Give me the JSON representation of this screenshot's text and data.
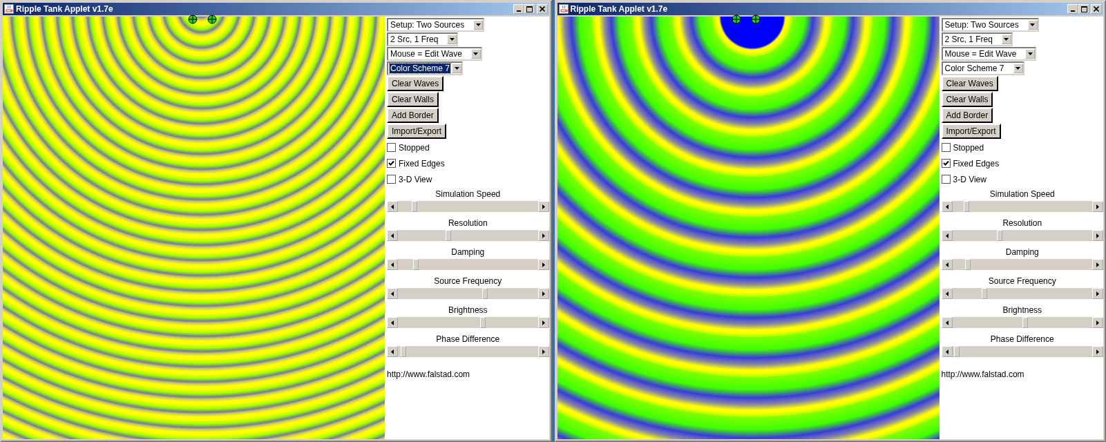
{
  "windows": [
    {
      "title": "Ripple Tank Applet v1.7e",
      "dropdowns": [
        {
          "value": "Setup: Two Sources",
          "focused": false
        },
        {
          "value": "2 Src, 1 Freq",
          "focused": false
        },
        {
          "value": "Mouse = Edit Wave",
          "focused": false
        },
        {
          "value": "Color Scheme 7",
          "focused": true
        }
      ],
      "buttons": [
        "Clear Waves",
        "Clear Walls",
        "Add Border",
        "Import/Export"
      ],
      "checkboxes": [
        {
          "label": "Stopped",
          "checked": false
        },
        {
          "label": "Fixed Edges",
          "checked": true
        },
        {
          "label": "3-D View",
          "checked": false
        }
      ],
      "sliders": [
        {
          "label": "Simulation Speed",
          "level": 0.1
        },
        {
          "label": "Resolution",
          "level": 0.34
        },
        {
          "label": "Damping",
          "level": 0.11
        },
        {
          "label": "Source Frequency",
          "level": 0.6
        },
        {
          "label": "Brightness",
          "level": 0.59
        },
        {
          "label": "Phase Difference",
          "level": 0.02
        }
      ],
      "link": "http://www.falstad.com"
    },
    {
      "title": "Ripple Tank Applet v1.7e",
      "dropdowns": [
        {
          "value": "Setup: Two Sources",
          "focused": false
        },
        {
          "value": "2 Src, 1 Freq",
          "focused": false
        },
        {
          "value": "Mouse = Edit Wave",
          "focused": false
        },
        {
          "value": "Color Scheme 7",
          "focused": false
        }
      ],
      "buttons": [
        "Clear Waves",
        "Clear Walls",
        "Add Border",
        "Import/Export"
      ],
      "checkboxes": [
        {
          "label": "Stopped",
          "checked": false
        },
        {
          "label": "Fixed Edges",
          "checked": true
        },
        {
          "label": "3-D View",
          "checked": false
        }
      ],
      "sliders": [
        {
          "label": "Simulation Speed",
          "level": 0.08
        },
        {
          "label": "Resolution",
          "level": 0.32
        },
        {
          "label": "Damping",
          "level": 0.09
        },
        {
          "label": "Source Frequency",
          "level": 0.21
        },
        {
          "label": "Brightness",
          "level": 0.5
        },
        {
          "label": "Phase Difference",
          "level": 0.01
        }
      ],
      "link": "http://www.falstad.com"
    }
  ]
}
